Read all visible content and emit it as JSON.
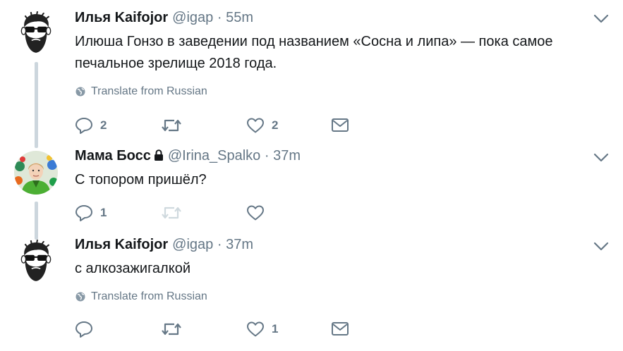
{
  "colors": {
    "text": "#14171a",
    "secondary": "#657786",
    "thread_line": "#ccd6dd",
    "disabled_icon": "#cfd9de"
  },
  "tweets": [
    {
      "name": "Илья Kaifojor",
      "handle": "@igap",
      "separator": "·",
      "time": "55m",
      "text_lines": [
        "Илюша Гонзо в заведении под названием «Сосна и липа» — пока самое",
        "печальное зрелище 2018 года."
      ],
      "translate": "Translate from Russian",
      "reply_count": "2",
      "retweet_count": "",
      "like_count": "2",
      "avatar_icon": "bearded-man-sunglasses-icon",
      "protected": false
    },
    {
      "name": "Мама Босс",
      "handle": "@Irina_Spalko",
      "separator": "·",
      "time": "37m",
      "text_lines": [
        "С топором пришёл?"
      ],
      "translate": "",
      "reply_count": "1",
      "retweet_count": "",
      "like_count": "",
      "avatar_icon": "woman-green-jacket-parrots-photo",
      "protected": true
    },
    {
      "name": "Илья Kaifojor",
      "handle": "@igap",
      "separator": "·",
      "time": "37m",
      "text_lines": [
        "с алкозажигалкой"
      ],
      "translate": "Translate from Russian",
      "reply_count": "",
      "retweet_count": "",
      "like_count": "1",
      "avatar_icon": "bearded-man-sunglasses-icon",
      "protected": false
    }
  ]
}
